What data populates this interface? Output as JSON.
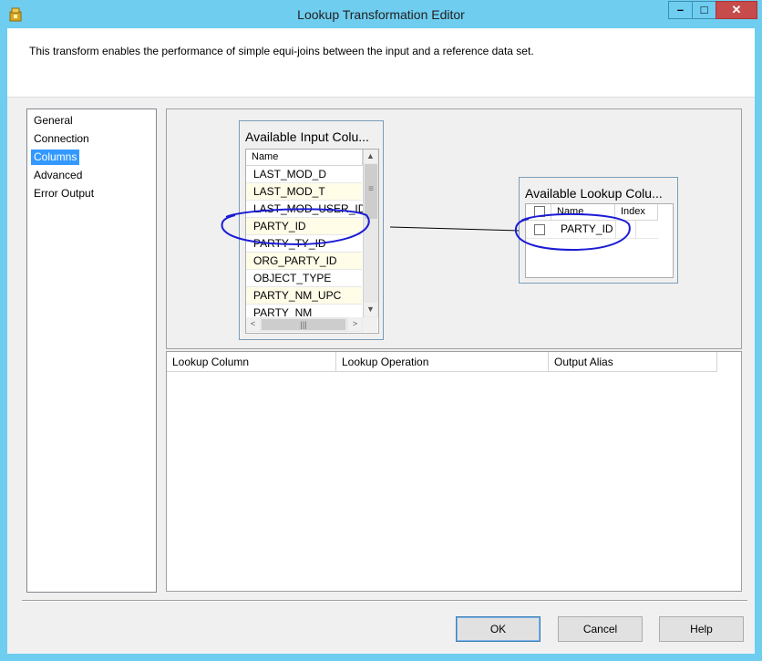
{
  "window": {
    "title": "Lookup Transformation Editor",
    "minimize_glyph": "–",
    "maximize_glyph": "□",
    "close_glyph": "✕"
  },
  "banner": {
    "description": "This transform enables the performance of simple equi-joins between the input and a reference data set."
  },
  "nav": {
    "items": [
      {
        "label": "General"
      },
      {
        "label": "Connection"
      },
      {
        "label": "Columns",
        "selected": true
      },
      {
        "label": "Advanced"
      },
      {
        "label": "Error Output"
      }
    ]
  },
  "input_columns": {
    "title": "Available Input Colu...",
    "header": "Name",
    "rows": [
      "LAST_MOD_D",
      "LAST_MOD_T",
      "LAST_MOD_USER_ID",
      "PARTY_ID",
      "PARTY_TY_ID",
      "ORG_PARTY_ID",
      "OBJECT_TYPE",
      "PARTY_NM_UPC",
      "PARTY_NM"
    ]
  },
  "lookup_columns": {
    "title": "Available Lookup Colu...",
    "header_name": "Name",
    "header_index": "Index",
    "rows": [
      {
        "name": "PARTY_ID",
        "checked": false
      }
    ]
  },
  "mapping_grid": {
    "headers": [
      "Lookup Column",
      "Lookup Operation",
      "Output Alias"
    ]
  },
  "buttons": {
    "ok": "OK",
    "cancel": "Cancel",
    "help": "Help"
  },
  "colors": {
    "title_bar": "#6fcdf0",
    "selection": "#3399ff",
    "annotation_ink": "#1b1bd6",
    "close_button": "#c74b4b"
  },
  "icons": {
    "app": "package-icon",
    "scroll_up": "▲",
    "scroll_down": "▼",
    "scroll_left": "<",
    "scroll_right": ">",
    "scroll_grip": "≡",
    "hscroll_grip": "|||"
  }
}
